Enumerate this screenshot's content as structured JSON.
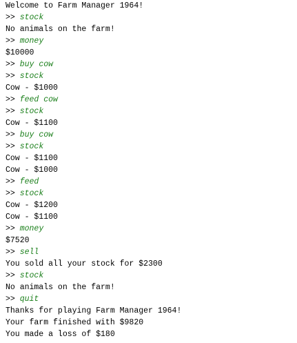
{
  "colors": {
    "background": "#ffffff",
    "output_text": "#000000",
    "command_text": "#1a7f1a"
  },
  "terminal": {
    "prompt": ">>",
    "lines": [
      {
        "type": "output",
        "text": "Welcome to Farm Manager 1964!"
      },
      {
        "type": "command",
        "text": "stock"
      },
      {
        "type": "output",
        "text": "No animals on the farm!"
      },
      {
        "type": "command",
        "text": "money"
      },
      {
        "type": "output",
        "text": "$10000"
      },
      {
        "type": "command",
        "text": "buy cow"
      },
      {
        "type": "command",
        "text": "stock"
      },
      {
        "type": "output",
        "text": "Cow - $1000"
      },
      {
        "type": "command",
        "text": "feed cow"
      },
      {
        "type": "command",
        "text": "stock"
      },
      {
        "type": "output",
        "text": "Cow - $1100"
      },
      {
        "type": "command",
        "text": "buy cow"
      },
      {
        "type": "command",
        "text": "stock"
      },
      {
        "type": "output",
        "text": "Cow - $1100"
      },
      {
        "type": "output",
        "text": "Cow - $1000"
      },
      {
        "type": "command",
        "text": "feed"
      },
      {
        "type": "command",
        "text": "stock"
      },
      {
        "type": "output",
        "text": "Cow - $1200"
      },
      {
        "type": "output",
        "text": "Cow - $1100"
      },
      {
        "type": "command",
        "text": "money"
      },
      {
        "type": "output",
        "text": "$7520"
      },
      {
        "type": "command",
        "text": "sell"
      },
      {
        "type": "output",
        "text": "You sold all your stock for $2300"
      },
      {
        "type": "command",
        "text": "stock"
      },
      {
        "type": "output",
        "text": "No animals on the farm!"
      },
      {
        "type": "command",
        "text": "quit"
      },
      {
        "type": "output",
        "text": "Thanks for playing Farm Manager 1964!"
      },
      {
        "type": "output",
        "text": "Your farm finished with $9820"
      },
      {
        "type": "output",
        "text": "You made a loss of $180"
      }
    ]
  }
}
